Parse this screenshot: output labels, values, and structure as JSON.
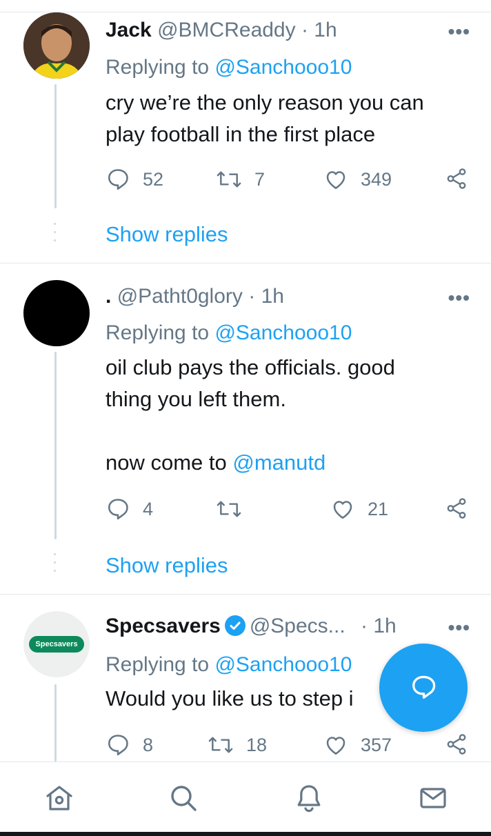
{
  "tweets": [
    {
      "name": "Jack",
      "handle": "@BMCReaddy",
      "time": "· 1h",
      "replying_prefix": "Replying to ",
      "replying_handle": "@Sanchooo10",
      "body_lines": [
        "cry we’re the only reason you can",
        "play football in the first place"
      ],
      "replies": "52",
      "retweets": "7",
      "likes": "349",
      "show_replies": "Show replies"
    },
    {
      "name": ".",
      "handle": "@Patht0glory",
      "time": "· 1h",
      "replying_prefix": "Replying to ",
      "replying_handle": "@Sanchooo10",
      "body_lines": [
        "oil club pays the officials. good",
        "thing you left them."
      ],
      "body_extra_prefix": "now come to ",
      "body_extra_mention": "@manutd",
      "replies": "4",
      "retweets": "",
      "likes": "21",
      "show_replies": "Show replies"
    },
    {
      "name": "Specsavers",
      "handle": "@Specs...",
      "time": "· 1h",
      "replying_prefix": "Replying to ",
      "replying_handle": "@Sanchooo10",
      "body_lines": [
        "Would you like us to step i"
      ],
      "logo_text": "Specsavers",
      "replies": "8",
      "retweets": "18",
      "likes": "357"
    }
  ],
  "more_icon": "more-dots-icon",
  "colors": {
    "accent": "#1da1f2",
    "muted": "#657786",
    "text": "#14171a",
    "specsavers_green": "#0d8a5b"
  },
  "nav": [
    "home-icon",
    "search-icon",
    "notifications-icon",
    "messages-icon"
  ]
}
